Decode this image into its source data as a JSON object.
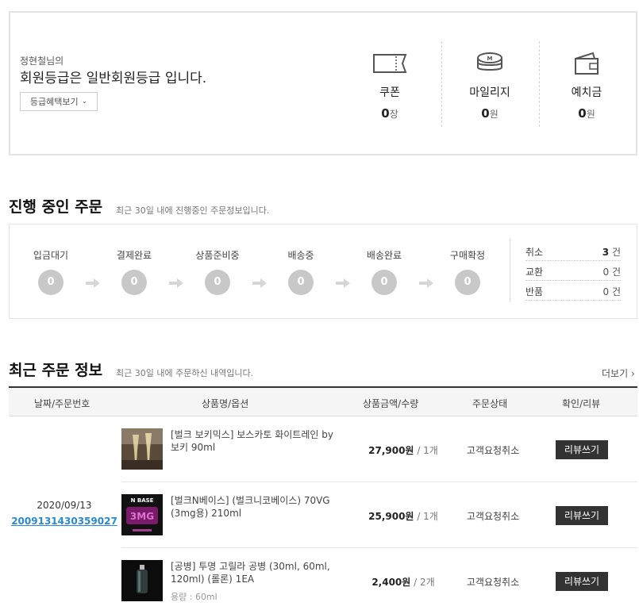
{
  "member": {
    "name": "정현철님의",
    "grade_text": "회원등급은 일반회원등급 입니다.",
    "benefit_button": "등급혜택보기",
    "stats": [
      {
        "label": "쿠폰",
        "value": "0",
        "unit": "장",
        "icon": "coupon-icon"
      },
      {
        "label": "마일리지",
        "value": "0",
        "unit": "원",
        "icon": "coins-icon"
      },
      {
        "label": "예치금",
        "value": "0",
        "unit": "원",
        "icon": "wallet-icon"
      }
    ]
  },
  "progress": {
    "title": "진행 중인 주문",
    "description": "최근 30일 내에 진행중인 주문정보입니다.",
    "steps": [
      {
        "label": "입금대기",
        "count": "0"
      },
      {
        "label": "결제완료",
        "count": "0"
      },
      {
        "label": "상품준비중",
        "count": "0"
      },
      {
        "label": "배송중",
        "count": "0"
      },
      {
        "label": "배송완료",
        "count": "0"
      },
      {
        "label": "구매확정",
        "count": "0"
      }
    ],
    "side": [
      {
        "label": "취소",
        "count": "3",
        "unit": "건"
      },
      {
        "label": "교환",
        "count": "0",
        "unit": "건"
      },
      {
        "label": "반품",
        "count": "0",
        "unit": "건"
      }
    ]
  },
  "recent": {
    "title": "최근 주문 정보",
    "description": "최근 30일 내에 주문하신 내역입니다.",
    "more": "더보기",
    "columns": [
      "날짜/주문번호",
      "상품명/옵션",
      "상품금액/수량",
      "주문상태",
      "확인/리뷰"
    ],
    "order": {
      "date": "2020/09/13",
      "number": "2009131430359027",
      "items": [
        {
          "name": "[벌크 보키믹스] 보스카토 화이트레인 by 보키 90ml",
          "option": "",
          "price": "27,900원",
          "qty": "1개",
          "status": "고객요청취소",
          "review": "리뷰쓰기"
        },
        {
          "name": "[벌크N베이스] (벌크니코베이스) 70VG (3mg용) 210ml",
          "option": "",
          "price": "25,900원",
          "qty": "1개",
          "status": "고객요청취소",
          "review": "리뷰쓰기",
          "thumb_text_top": "N BASE",
          "thumb_text_mid": "3MG"
        },
        {
          "name": "[공병] 투명 고릴라 공병 (30ml, 60ml, 120ml) (롤론) 1EA",
          "option": "용량 : 60ml",
          "price": "2,400원",
          "qty": "2개",
          "status": "고객요청취소",
          "review": "리뷰쓰기"
        }
      ]
    }
  }
}
